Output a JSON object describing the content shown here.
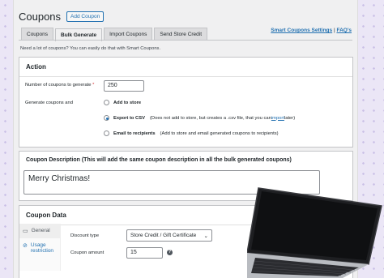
{
  "header": {
    "title": "Coupons",
    "add_button": "Add Coupon"
  },
  "tabs": [
    {
      "label": "Coupons"
    },
    {
      "label": "Bulk Generate"
    },
    {
      "label": "Import Coupons"
    },
    {
      "label": "Send Store Credit"
    }
  ],
  "links": {
    "settings": "Smart Coupons Settings",
    "separator": "|",
    "faq": "FAQ's"
  },
  "intro": "Need a lot of coupons? You can easily do that with Smart Coupons.",
  "action": {
    "title": "Action",
    "count_label": "Number of coupons to generate",
    "required_mark": "*",
    "count_value": "250",
    "generate_label": "Generate coupons and",
    "options": [
      {
        "label": "Add to store",
        "desc": "",
        "checked": false
      },
      {
        "label": "Export to CSV",
        "desc_pre": "(Does not add to store, but creates a .csv file, that you can ",
        "desc_link": "import",
        "desc_post": " later)",
        "checked": true
      },
      {
        "label": "Email to recipients",
        "desc": "(Add to store and email generated coupons to recipients)",
        "checked": false
      }
    ]
  },
  "description": {
    "title": "Coupon Description (This will add the same coupon description in all the bulk generated coupons)",
    "value": "Merry Christmas!"
  },
  "coupon_data": {
    "title": "Coupon Data",
    "side_tabs": [
      {
        "label": "General",
        "icon": "ticket-icon"
      },
      {
        "label": "Usage restriction",
        "icon": "block-icon"
      }
    ],
    "discount_label": "Discount type",
    "discount_value": "Store Credit / Gift Certificate",
    "amount_label": "Coupon amount",
    "amount_value": "15",
    "help": "?"
  }
}
